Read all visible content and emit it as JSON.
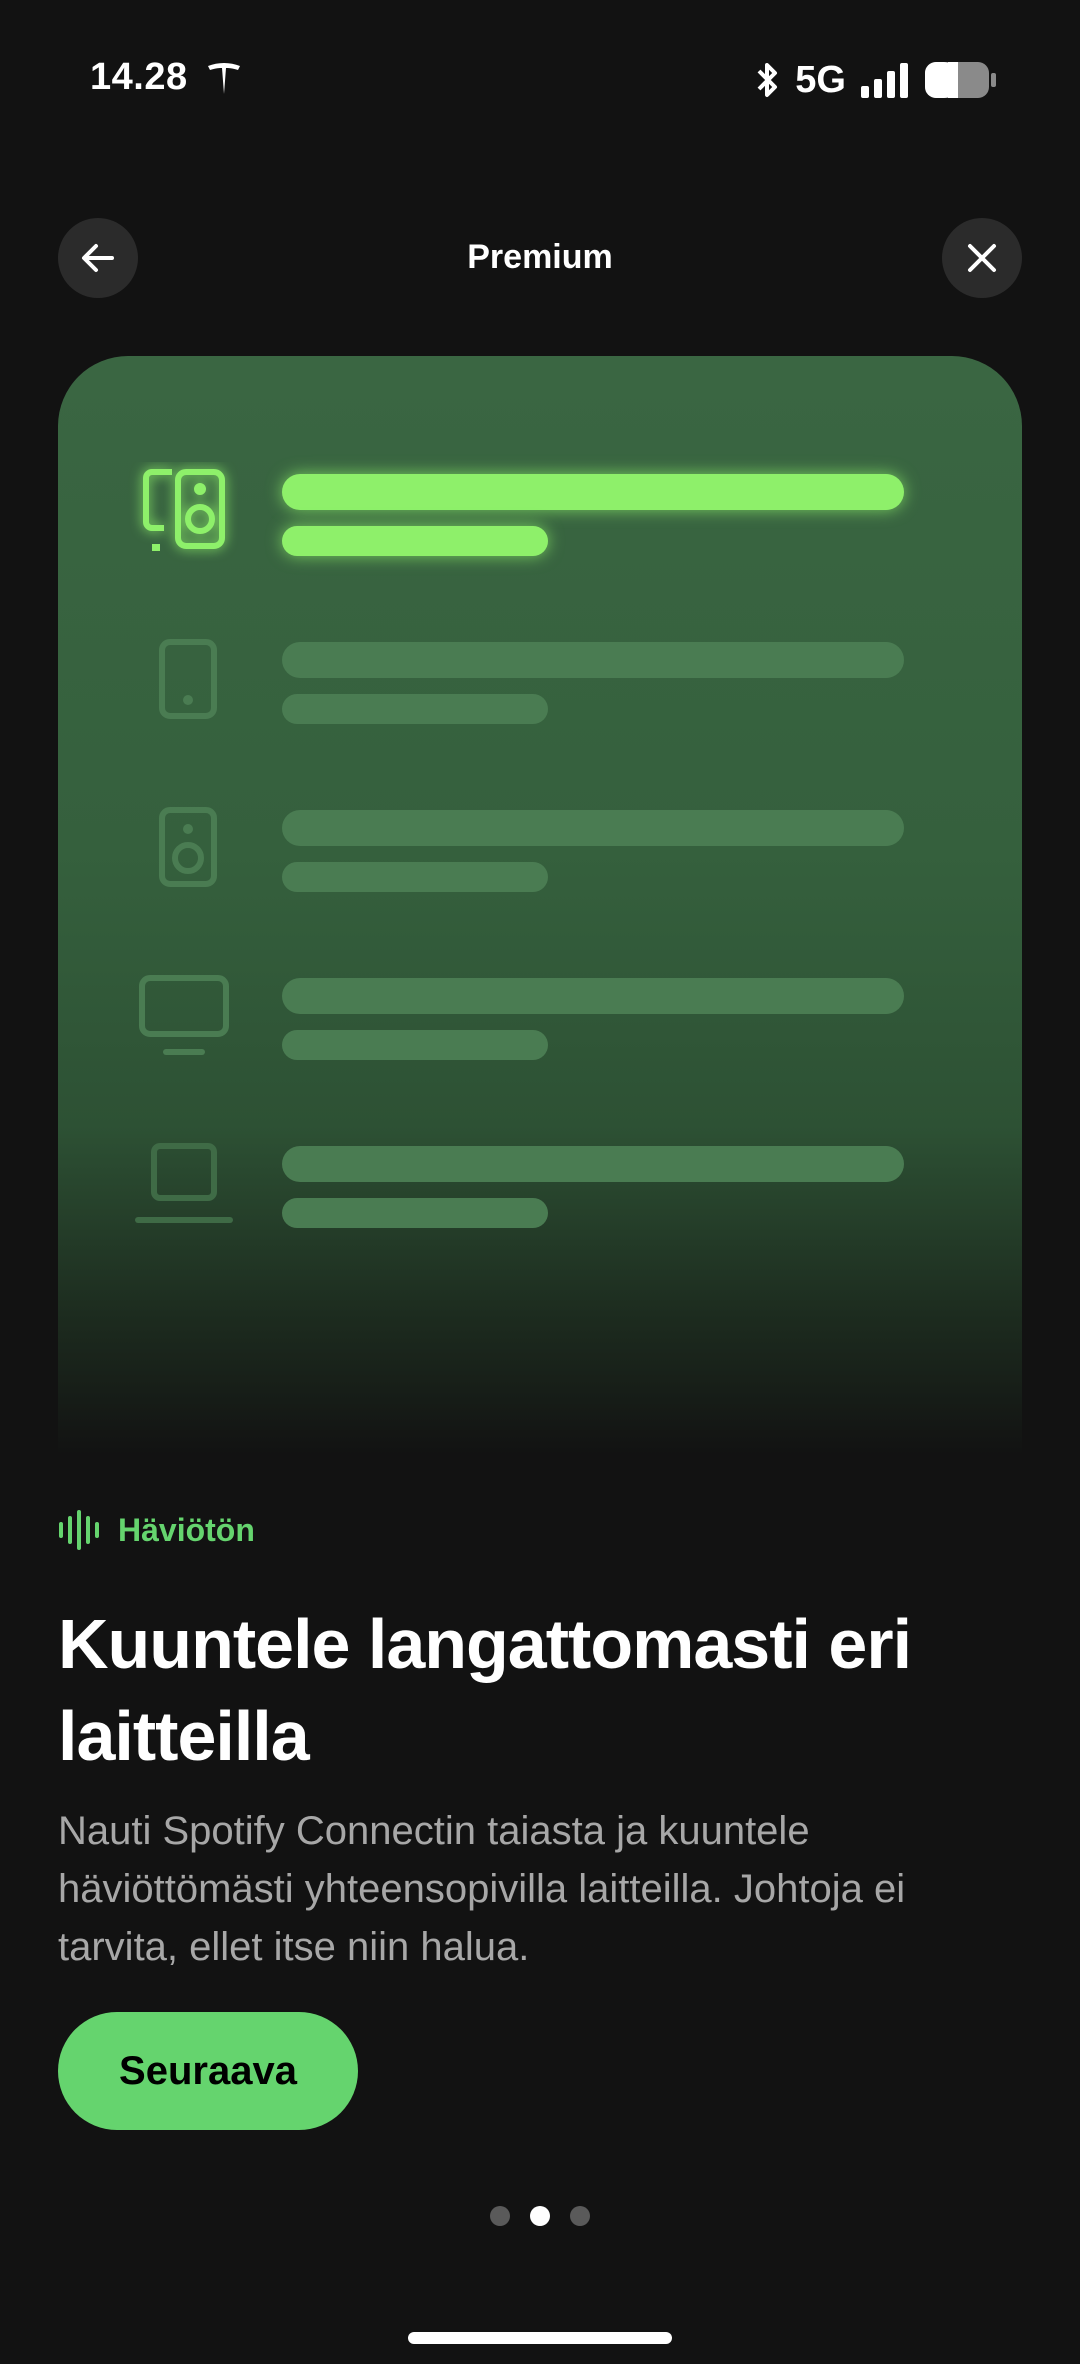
{
  "status_bar": {
    "time": "14.28",
    "network": "5G",
    "icons": [
      "tesla-icon",
      "bluetooth-icon",
      "signal-icon",
      "battery-icon"
    ]
  },
  "header": {
    "title": "Premium",
    "back_icon": "arrow-left-icon",
    "close_icon": "close-icon"
  },
  "hero": {
    "devices": [
      {
        "name": "speaker-with-phone",
        "icon": "speaker-phone-icon",
        "active": true
      },
      {
        "name": "phone",
        "icon": "phone-icon",
        "active": false
      },
      {
        "name": "speaker",
        "icon": "speaker-icon",
        "active": false
      },
      {
        "name": "tv",
        "icon": "tv-icon",
        "active": false
      },
      {
        "name": "laptop",
        "icon": "laptop-icon",
        "active": false
      }
    ]
  },
  "tag": {
    "icon": "audio-waveform-icon",
    "label": "Häviötön"
  },
  "headline": "Kuuntele langattomasti eri laitteilla",
  "description": "Nauti Spotify Connectin taiasta ja kuuntele häviöttömästi yhteensopivilla laitteilla. Johtoja ei tarvita, ellet itse niin halua.",
  "next_button": {
    "label": "Seuraava"
  },
  "pager": {
    "current": 2,
    "total": 3
  },
  "colors": {
    "background": "#121212",
    "accent": "#65d46e",
    "active_glow": "#8ef06a",
    "card": "#3a6642"
  }
}
